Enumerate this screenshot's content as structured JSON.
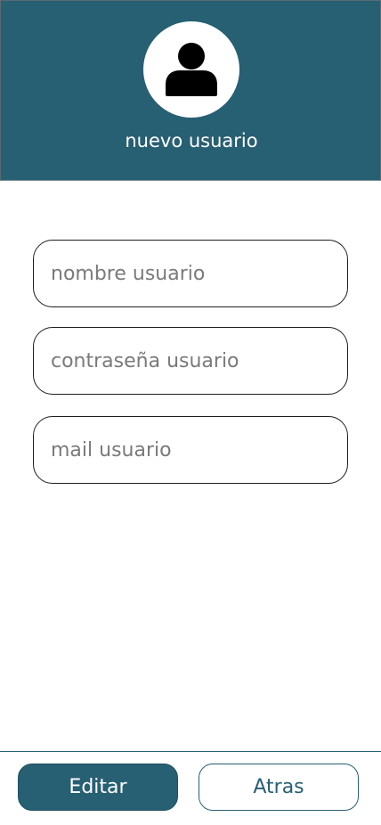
{
  "header": {
    "title": "nuevo usuario",
    "avatar_icon": "user-icon"
  },
  "form": {
    "fields": [
      {
        "name": "nombre",
        "placeholder": "nombre usuario",
        "value": ""
      },
      {
        "name": "contrasena",
        "placeholder": "contraseña usuario",
        "value": ""
      },
      {
        "name": "mail",
        "placeholder": "mail usuario",
        "value": ""
      }
    ]
  },
  "actions": {
    "primary_label": "Editar",
    "secondary_label": "Atras"
  },
  "colors": {
    "brand": "#275f73",
    "background": "#ffffff",
    "field_border": "#1e1e1e",
    "placeholder": "#7a7a7a"
  }
}
